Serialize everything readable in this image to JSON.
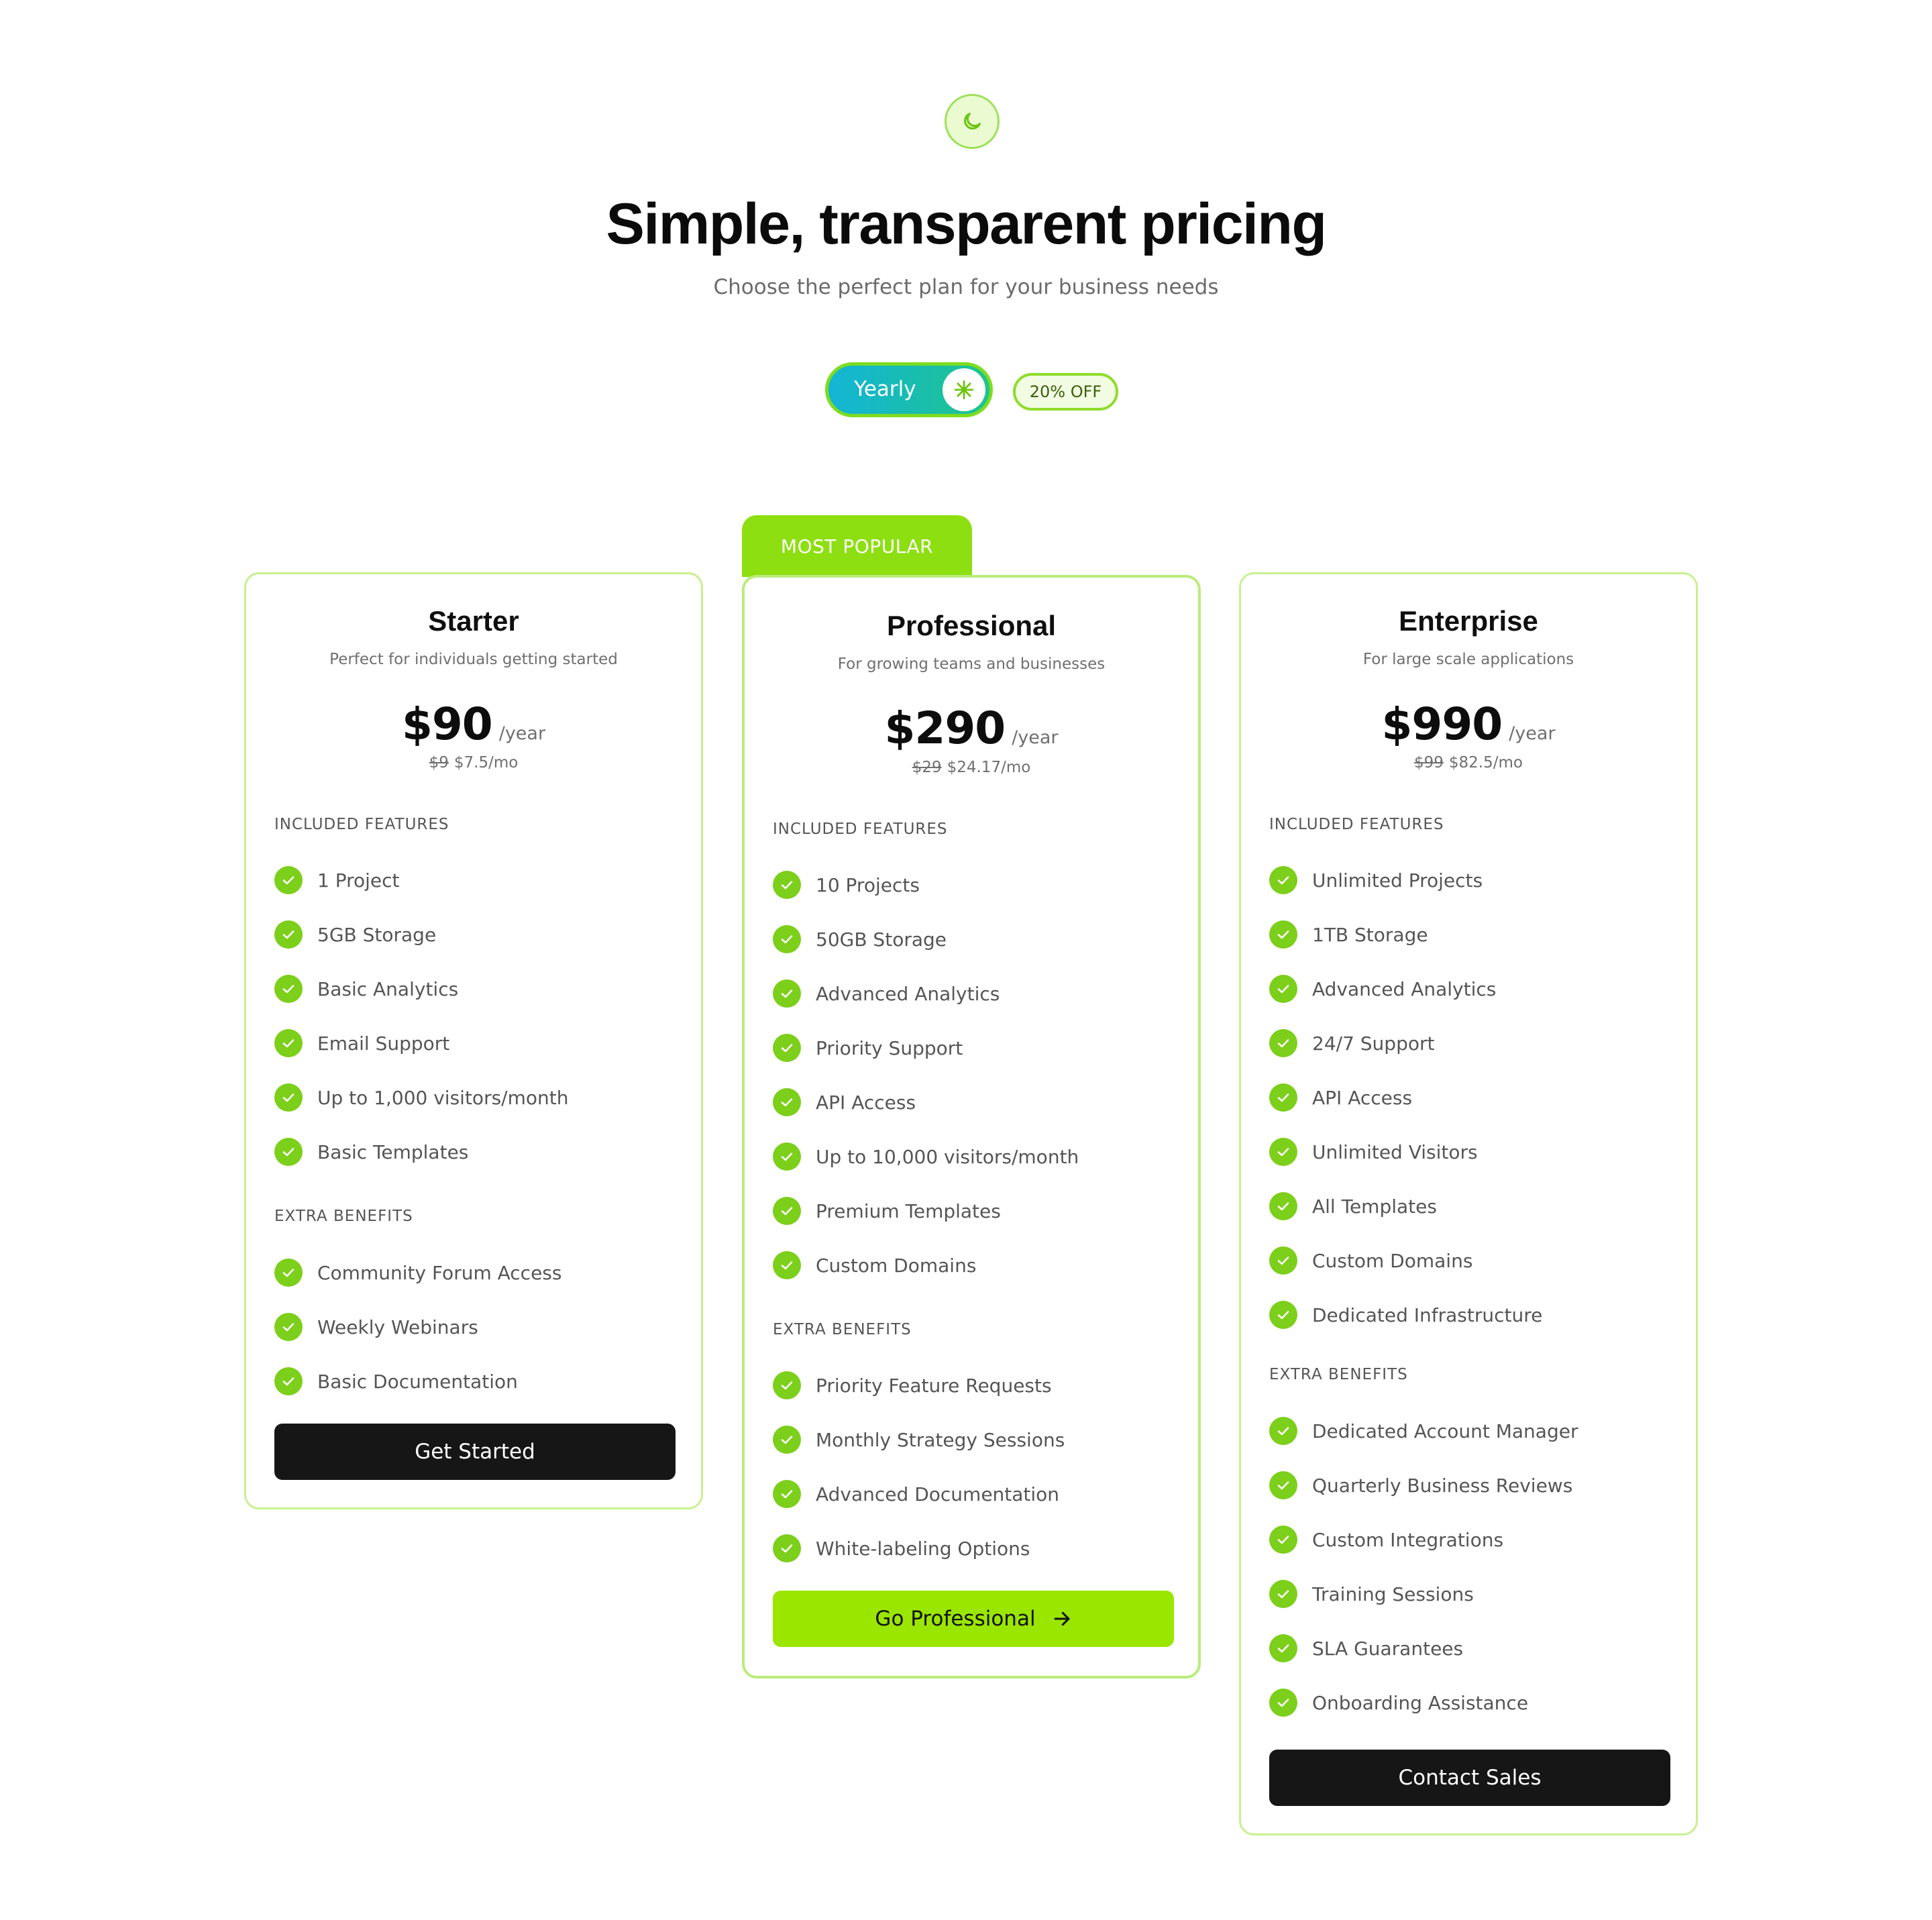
{
  "header": {
    "icon": "moon-icon",
    "title": "Simple, transparent pricing",
    "subtitle": "Choose the perfect plan for your business needs"
  },
  "billing": {
    "toggle_label": "Yearly",
    "toggle_on": true,
    "discount_label": "20% OFF"
  },
  "popular_label": "MOST POPULAR",
  "section_labels": {
    "included": "INCLUDED FEATURES",
    "extra": "EXTRA BENEFITS"
  },
  "colors": {
    "accent": "#8ddf11",
    "button_lime": "#9ae600",
    "button_dark": "#161616",
    "toggle_gradient_start": "#13b5d6",
    "toggle_gradient_end": "#1ec48d"
  },
  "plans": [
    {
      "name": "Starter",
      "description": "Perfect for individuals getting started",
      "price": "$90",
      "period": "/year",
      "old_monthly": "$9",
      "monthly": "$7.5/mo",
      "features": [
        "1 Project",
        "5GB Storage",
        "Basic Analytics",
        "Email Support",
        "Up to 1,000 visitors/month",
        "Basic Templates"
      ],
      "extras": [
        "Community Forum Access",
        "Weekly Webinars",
        "Basic Documentation"
      ],
      "cta": "Get Started"
    },
    {
      "name": "Professional",
      "description": "For growing teams and businesses",
      "price": "$290",
      "period": "/year",
      "old_monthly": "$29",
      "monthly": "$24.17/mo",
      "features": [
        "10 Projects",
        "50GB Storage",
        "Advanced Analytics",
        "Priority Support",
        "API Access",
        "Up to 10,000 visitors/month",
        "Premium Templates",
        "Custom Domains"
      ],
      "extras": [
        "Priority Feature Requests",
        "Monthly Strategy Sessions",
        "Advanced Documentation",
        "White-labeling Options"
      ],
      "cta": "Go Professional"
    },
    {
      "name": "Enterprise",
      "description": "For large scale applications",
      "price": "$990",
      "period": "/year",
      "old_monthly": "$99",
      "monthly": "$82.5/mo",
      "features": [
        "Unlimited Projects",
        "1TB Storage",
        "Advanced Analytics",
        "24/7 Support",
        "API Access",
        "Unlimited Visitors",
        "All Templates",
        "Custom Domains",
        "Dedicated Infrastructure"
      ],
      "extras": [
        "Dedicated Account Manager",
        "Quarterly Business Reviews",
        "Custom Integrations",
        "Training Sessions",
        "SLA Guarantees",
        "Onboarding Assistance"
      ],
      "cta": "Contact Sales"
    }
  ]
}
